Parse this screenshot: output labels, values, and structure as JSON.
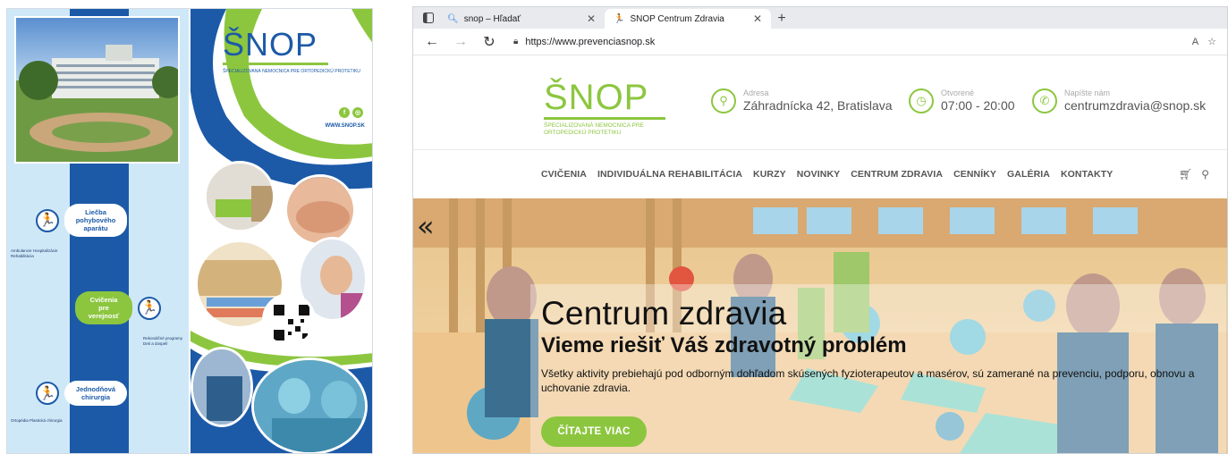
{
  "brochure": {
    "logo": "ŠNOP",
    "logo_sub": "ŠPECIALIZOVANÁ NEMOCNICA PRE ORTOPEDICKÚ PROTETIKU",
    "website": "WWW.SNOP.SK",
    "sections": [
      {
        "title": "Liečba pohybového aparátu",
        "items": "Ambulancie Hospitalizácie Rehabilitácia"
      },
      {
        "title": "Cvičenia pre verejnosť",
        "items": "Rekondičné programy Deti a dospelí"
      },
      {
        "title": "Jednodňová chirurgia",
        "items": "Ortopédia Plastická chirurgia"
      }
    ]
  },
  "browser": {
    "tabs": [
      {
        "title": "snop – Hľadať",
        "icon": "search-icon",
        "active": false
      },
      {
        "title": "ŠNOP Centrum Zdravia",
        "icon": "runner-icon",
        "active": true
      }
    ],
    "url": "https://www.prevenciasnop.sk",
    "reader_label": "A",
    "site": {
      "logo": "ŠNOP",
      "logo_sub": "ŠPECIALIZOVANÁ NEMOCNICA PRE ORTOPEDICKÚ PROTETIKU",
      "address_label": "Adresa",
      "address_value": "Záhradnícka 42, Bratislava",
      "hours_label": "Otvorené",
      "hours_value": "07:00 - 20:00",
      "email_label": "Napíšte nám",
      "email_value": "centrumzdravia@snop.sk",
      "menu": [
        "CVIČENIA",
        "INDIVIDUÁLNA REHABILITÁCIA",
        "KURZY",
        "NOVINKY",
        "CENTRUM ZDRAVIA",
        "CENNÍKY",
        "GALÉRIA",
        "KONTAKTY"
      ],
      "hero_title": "Centrum zdravia",
      "hero_subtitle": "Vieme riešiť Váš zdravotný problém",
      "hero_text": "Všetky aktivity prebiehajú pod odborným dohľadom skúsených fyzioterapeutov a masérov, sú zamerané na prevenciu, podporu, obnovu a uchovanie zdravia.",
      "cta": "ČÍTAJTE VIAC",
      "prev_arrow": "«"
    }
  },
  "colors": {
    "brand_blue": "#1c5aa8",
    "brand_green": "#8cc63f"
  }
}
